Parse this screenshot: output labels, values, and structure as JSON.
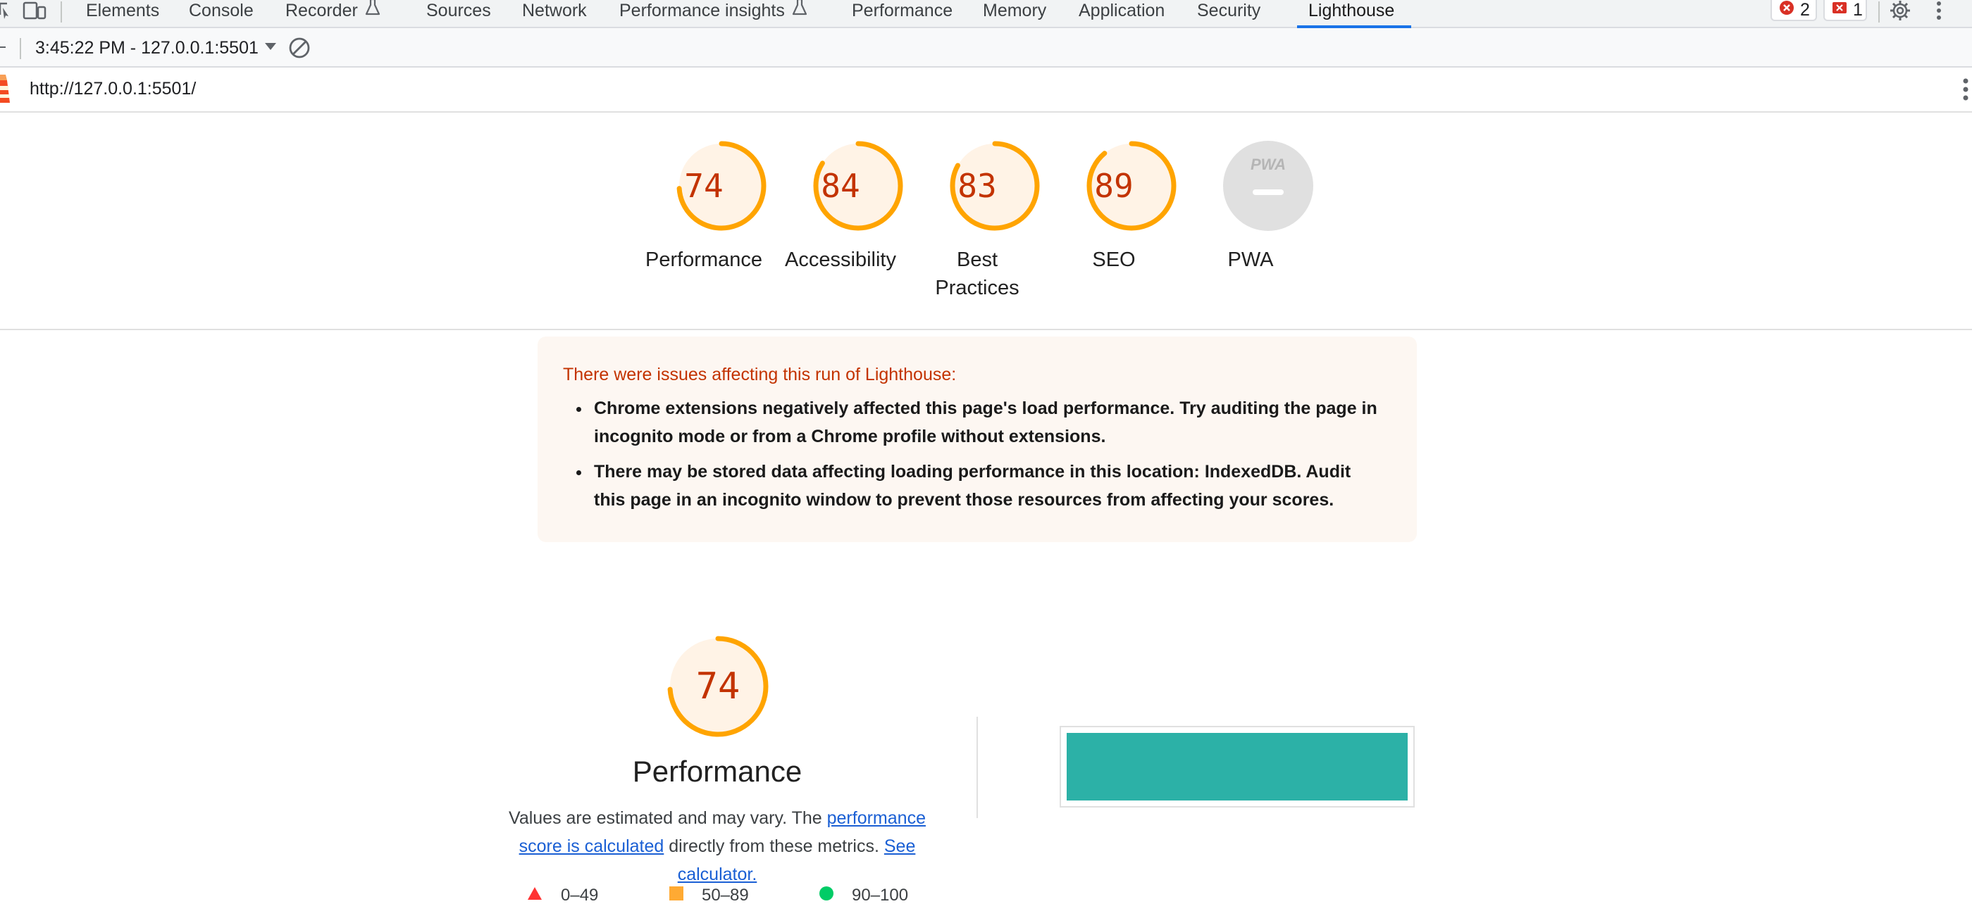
{
  "devtools": {
    "tabs": [
      {
        "label": "Elements"
      },
      {
        "label": "Console"
      },
      {
        "label": "Recorder"
      },
      {
        "label": "Sources"
      },
      {
        "label": "Network"
      },
      {
        "label": "Performance insights"
      },
      {
        "label": "Performance"
      },
      {
        "label": "Memory"
      },
      {
        "label": "Application"
      },
      {
        "label": "Security"
      },
      {
        "label": "Lighthouse"
      }
    ],
    "active_tab": "Lighthouse",
    "error_count": "2",
    "issue_count": "1"
  },
  "report_selector": {
    "value": "3:45:22 PM - 127.0.0.1:5501"
  },
  "report": {
    "url": "http://127.0.0.1:5501/",
    "categories": [
      {
        "label": "Performance",
        "score": "74",
        "fraction": 0.74
      },
      {
        "label": "Accessibility",
        "score": "84",
        "fraction": 0.84
      },
      {
        "label": "Best Practices",
        "score": "83",
        "fraction": 0.83
      },
      {
        "label": "SEO",
        "score": "89",
        "fraction": 0.89
      },
      {
        "label": "PWA",
        "score": "",
        "fraction": 0
      }
    ],
    "warnings": {
      "title": "There were issues affecting this run of Lighthouse:",
      "items": [
        "Chrome extensions negatively affected this page's load performance. Try auditing the page in incognito mode or from a Chrome profile without extensions.",
        "There may be stored data affecting loading performance in this location: IndexedDB. Audit this page in an incognito window to prevent those resources from affecting your scores."
      ]
    },
    "performance": {
      "score": "74",
      "fraction": 0.74,
      "title": "Performance",
      "desc_prefix": "Values are estimated and may vary. The ",
      "desc_link1": "performance score is calculated",
      "desc_middle": " directly from these metrics. ",
      "desc_link2": "See calculator."
    },
    "legend": [
      {
        "label": "0–49",
        "shape": "triangle",
        "color": "#f33"
      },
      {
        "label": "50–89",
        "shape": "square",
        "color": "#fa3"
      },
      {
        "label": "90–100",
        "shape": "circle",
        "color": "#0c6"
      }
    ],
    "pwa_badge_text": "PWA"
  },
  "colors": {
    "average": "#ffa400",
    "average_bg": "#fff3e6",
    "average_text": "#c33300",
    "accent": "#1a73e8",
    "screenshot": "#2cb1a7"
  }
}
